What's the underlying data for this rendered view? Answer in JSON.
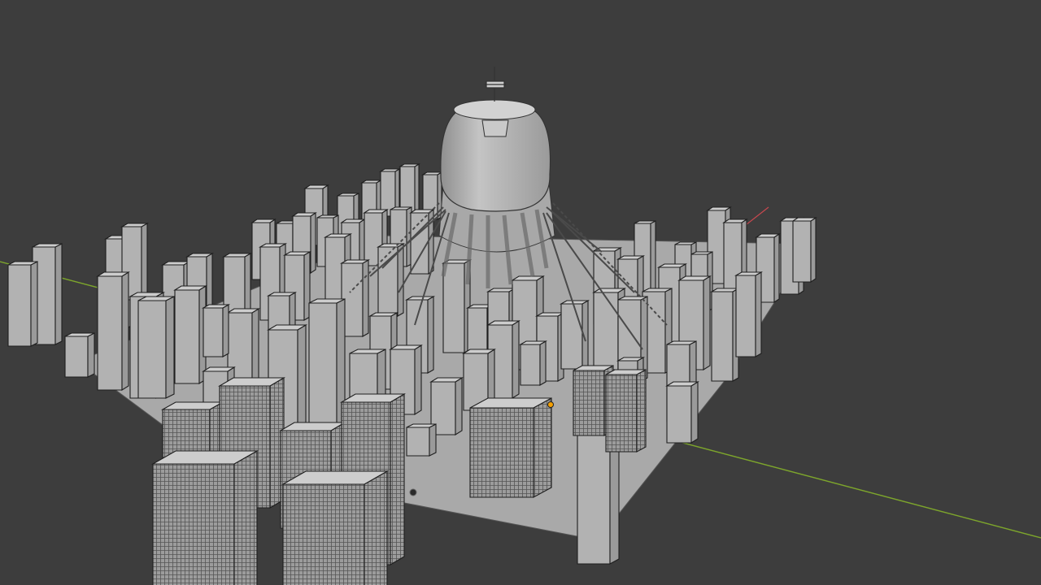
{
  "viewport": {
    "view": "3d-viewport",
    "shading": "solid",
    "background_color": "#3d3d3d"
  },
  "colors": {
    "x_axis": "#c8484f",
    "y_axis": "#7da52c",
    "object_fill": "#b4b4b4",
    "object_edge": "#1e1e1e",
    "ground": "#a9a9a9",
    "origin_marker": "#f5a000"
  },
  "scene": {
    "objects": [
      "ground-plane",
      "dome-tower",
      "skyscraper-blocks",
      "high-detail-blocks",
      "antenna",
      "support-cables"
    ]
  }
}
